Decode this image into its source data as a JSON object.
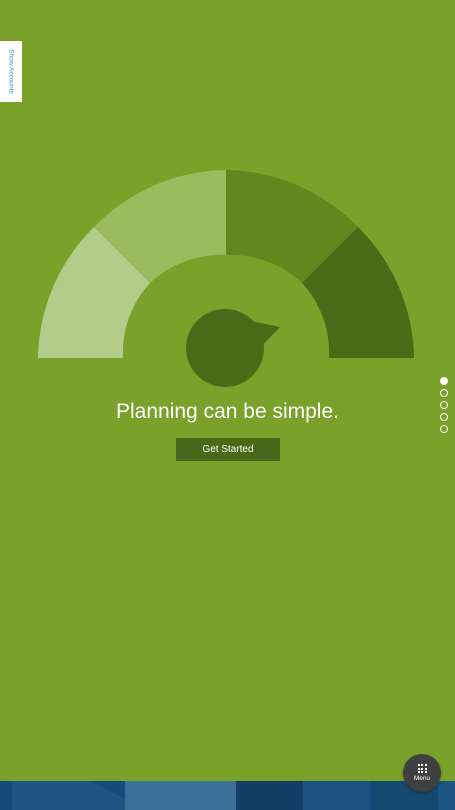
{
  "side_tab": {
    "label": "Show Accounts"
  },
  "hero": {
    "headline": "Planning can be simple.",
    "cta_label": "Get Started"
  },
  "gauge": {
    "segments": 4,
    "needle_icon": "gauge-needle-icon",
    "colors": [
      "#b4cc89",
      "#9bbb5e",
      "#65861f",
      "#4b6a18"
    ]
  },
  "pager": {
    "count": 5,
    "active_index": 0
  },
  "menu": {
    "label": "Menu",
    "icon": "grid-icon"
  },
  "colors": {
    "background": "#7aa22b",
    "button": "#4a6819",
    "footer": "#174c78",
    "fab": "#3f4140"
  }
}
